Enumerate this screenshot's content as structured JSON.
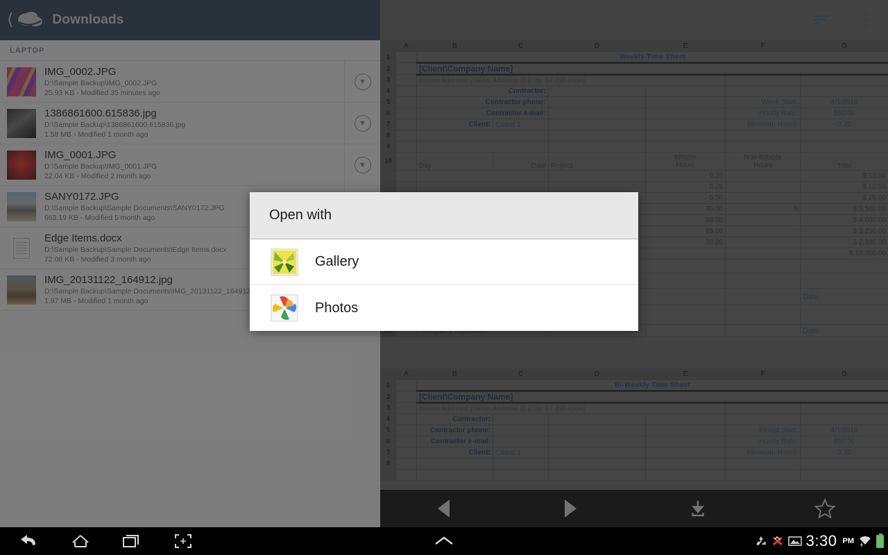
{
  "app": {
    "title": "Downloads",
    "back_icon": "back-chevron-icon",
    "logo_icon": "cloud-icon",
    "sort_icon": "sort-icon",
    "overflow_icon": "overflow-menu-icon"
  },
  "section": {
    "label": "LAPTOP"
  },
  "files": [
    {
      "name": "IMG_0002.JPG",
      "path": "D:\\Sample Backup\\IMG_0002.JPG",
      "meta": "25.93 KB - Modified 35 minutes ago",
      "thumb_kind": "image",
      "thumb_colors": [
        "#d23fa0",
        "#f0b030",
        "#8e3ad8",
        "#e8407a"
      ]
    },
    {
      "name": "1386861600.615836.jpg",
      "path": "D:\\Sample Backup\\1386861600.615836.jpg",
      "meta": "1.58 MB - Modified 1 month ago",
      "thumb_kind": "image",
      "thumb_colors": [
        "#2a2a2a",
        "#555555",
        "#777777",
        "#111111"
      ]
    },
    {
      "name": "IMG_0001.JPG",
      "path": "D:\\Sample Backup\\IMG_0001.JPG",
      "meta": "22.04 KB - Modified 2 month ago",
      "thumb_kind": "image",
      "thumb_colors": [
        "#8d1616",
        "#c62020",
        "#e03b2a",
        "#4a0c0c"
      ]
    },
    {
      "name": "SANY0172.JPG",
      "path": "D:\\Sample Backup\\Sample Documents\\SANY0172.JPG",
      "meta": "663.19 KB - Modified 5 month ago",
      "thumb_kind": "image",
      "thumb_colors": [
        "#8fb8d8",
        "#b9c3c0",
        "#6d6d63",
        "#cfc9ad"
      ]
    },
    {
      "name": "Edge Items.docx",
      "path": "D:\\Sample Backup\\Sample Documents\\Edge Items.docx",
      "meta": "72.08 KB - Modified 3 month ago",
      "thumb_kind": "document",
      "thumb_colors": []
    },
    {
      "name": "IMG_20131122_164912.jpg",
      "path": "D:\\Sample Backup\\Sample Documents\\IMG_20131122_164912.jpg",
      "meta": "1.97 MB - Modified 1 month ago",
      "thumb_kind": "image",
      "thumb_colors": [
        "#7e96ab",
        "#9e8a66",
        "#6b5336",
        "#c8a977"
      ]
    }
  ],
  "row_action_icon": "chevron-down-circle-icon",
  "dialog": {
    "title": "Open with",
    "items": [
      {
        "label": "Gallery",
        "icon": "gallery-app-icon"
      },
      {
        "label": "Photos",
        "icon": "photos-app-icon"
      }
    ]
  },
  "viewer_toolbar": {
    "buttons": [
      {
        "icon": "previous-page-icon",
        "name": "previous-page-button"
      },
      {
        "icon": "next-page-icon",
        "name": "next-page-button"
      },
      {
        "icon": "download-icon",
        "name": "download-button"
      },
      {
        "icon": "star-icon",
        "name": "favorite-button"
      }
    ]
  },
  "navbar": {
    "back_icon": "back-icon",
    "home_icon": "home-icon",
    "recents_icon": "recent-apps-icon",
    "screenshot_icon": "screenshot-icon",
    "expand_icon": "expand-up-icon",
    "status_icons": [
      "recycle-icon",
      "no-sync-icon",
      "screenshot-saved-icon",
      "wifi-icon",
      "battery-icon"
    ],
    "clock": "3:30",
    "ampm": "PM"
  },
  "spreadsheet": {
    "columns": [
      "A",
      "B",
      "C",
      "D",
      "E",
      "F",
      "G"
    ],
    "sheet1": {
      "title": "Weekly Time Sheet",
      "company": "[Client\\Company Name]",
      "address": "[Street Address] [Street Address 2] [City, ST ZIP code]",
      "labels": {
        "contractor": "Contractor:",
        "contractor_phone": "Contractor phone:",
        "contractor_email": "Contractor e-mail:",
        "client": "Client:"
      },
      "values": {
        "client": "Client 1"
      },
      "right_labels": {
        "week_start": "Week Start:",
        "hourly_rate": "Hourly Rate:",
        "minimum_hours": "Minimum Hours:"
      },
      "right_values": {
        "week_start": "4/1/2016",
        "hourly_rate": "$50.00",
        "minimum_hours": "0.25"
      },
      "table_headers": {
        "day": "Day",
        "date": "Date",
        "project": "Project",
        "billable": "Billable\nHours",
        "billable_l1": "Billable",
        "billable_l2": "Hours",
        "nonbillable_l1": "Non-Billable",
        "nonbillable_l2": "Hours",
        "total": "Total"
      },
      "rows": [
        {
          "billable": "0.20",
          "nonbillable": "",
          "total": "$ 12.50"
        },
        {
          "billable": "0.25",
          "nonbillable": "",
          "total": "$ 12.50"
        },
        {
          "billable": "0.50",
          "nonbillable": "",
          "total": "$ 25.00"
        },
        {
          "billable": "70.00",
          "nonbillable": "5",
          "total": "$ 3,500.00"
        },
        {
          "billable": "80.00",
          "nonbillable": "",
          "total": "$ 4,000.00"
        },
        {
          "billable": "65.00",
          "nonbillable": "",
          "total": "$ 3,250.00"
        },
        {
          "billable": "50.00",
          "nonbillable": "",
          "total": "$ 2,500.00"
        }
      ],
      "grand_total": "$ 13,300.00",
      "signature_label": "Company Signature",
      "date_label": "Date",
      "row_numbers_visible": [
        "1",
        "2",
        "3",
        "4",
        "5",
        "6",
        "7",
        "8",
        "9",
        "10",
        "21",
        "22"
      ]
    },
    "sheet2": {
      "title": "Bi-Weekly Time Sheet",
      "company": "[Client\\Company Name]",
      "address": "[Street Address] [Street Address 2] [City, ST ZIP code]",
      "labels": {
        "contractor": "Contractor:",
        "contractor_phone": "Contractor phone:",
        "contractor_email": "Contractor e-mail:",
        "client": "Client:"
      },
      "values": {
        "client": "Client 1"
      },
      "right_labels": {
        "period_start": "Period Start:",
        "hourly_rate": "Hourly Rate:",
        "minimum_hours": "Minimum Hours:"
      },
      "right_values": {
        "period_start": "4/1/2016",
        "hourly_rate": "$50.00",
        "minimum_hours": "0.25"
      },
      "row_numbers_visible": [
        "1",
        "2",
        "3",
        "4",
        "5",
        "6",
        "7",
        "8"
      ]
    }
  },
  "colors": {
    "appbar": "#2b3e54",
    "sheet_bg": "#6f6f6f",
    "sheet_title": "#2c3c66",
    "dialog_header": "#e8e8e8",
    "scrim": "rgba(40,40,40,0.58)"
  }
}
